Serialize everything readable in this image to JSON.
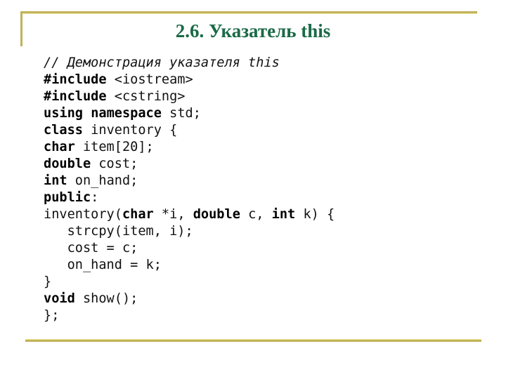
{
  "slide": {
    "title": "2.6. Указатель this",
    "colors": {
      "title": "#1a6a47",
      "rule": "#c2b25a",
      "text": "#111111"
    }
  },
  "code": {
    "lines": [
      [
        {
          "t": "// Демонстрация указателя this",
          "s": "cm"
        }
      ],
      [
        {
          "t": "#include",
          "s": "kw"
        },
        {
          "t": " <iostream>",
          "s": ""
        }
      ],
      [
        {
          "t": "#include",
          "s": "kw"
        },
        {
          "t": " <cstring>",
          "s": ""
        }
      ],
      [
        {
          "t": "using",
          "s": "kw"
        },
        {
          "t": " ",
          "s": ""
        },
        {
          "t": "namespace",
          "s": "kw"
        },
        {
          "t": " std;",
          "s": ""
        }
      ],
      [
        {
          "t": "class",
          "s": "kw"
        },
        {
          "t": " inventory {",
          "s": ""
        }
      ],
      [
        {
          "t": "char",
          "s": "kw"
        },
        {
          "t": " item[20];",
          "s": ""
        }
      ],
      [
        {
          "t": "double",
          "s": "kw"
        },
        {
          "t": " cost;",
          "s": ""
        }
      ],
      [
        {
          "t": "int",
          "s": "kw"
        },
        {
          "t": " on_hand;",
          "s": ""
        }
      ],
      [
        {
          "t": "public",
          "s": "kw"
        },
        {
          "t": ":",
          "s": ""
        }
      ],
      [
        {
          "t": "inventory(",
          "s": ""
        },
        {
          "t": "char",
          "s": "kw"
        },
        {
          "t": " *i, ",
          "s": ""
        },
        {
          "t": "double",
          "s": "kw"
        },
        {
          "t": " c, ",
          "s": ""
        },
        {
          "t": "int",
          "s": "kw"
        },
        {
          "t": " k) {",
          "s": ""
        }
      ],
      [
        {
          "t": "   strcpy(item, i);",
          "s": ""
        }
      ],
      [
        {
          "t": "   cost = c;",
          "s": ""
        }
      ],
      [
        {
          "t": "   on_hand = k;",
          "s": ""
        }
      ],
      [
        {
          "t": "}",
          "s": ""
        }
      ],
      [
        {
          "t": "void",
          "s": "kw"
        },
        {
          "t": " show();",
          "s": ""
        }
      ],
      [
        {
          "t": "};",
          "s": ""
        }
      ]
    ]
  }
}
